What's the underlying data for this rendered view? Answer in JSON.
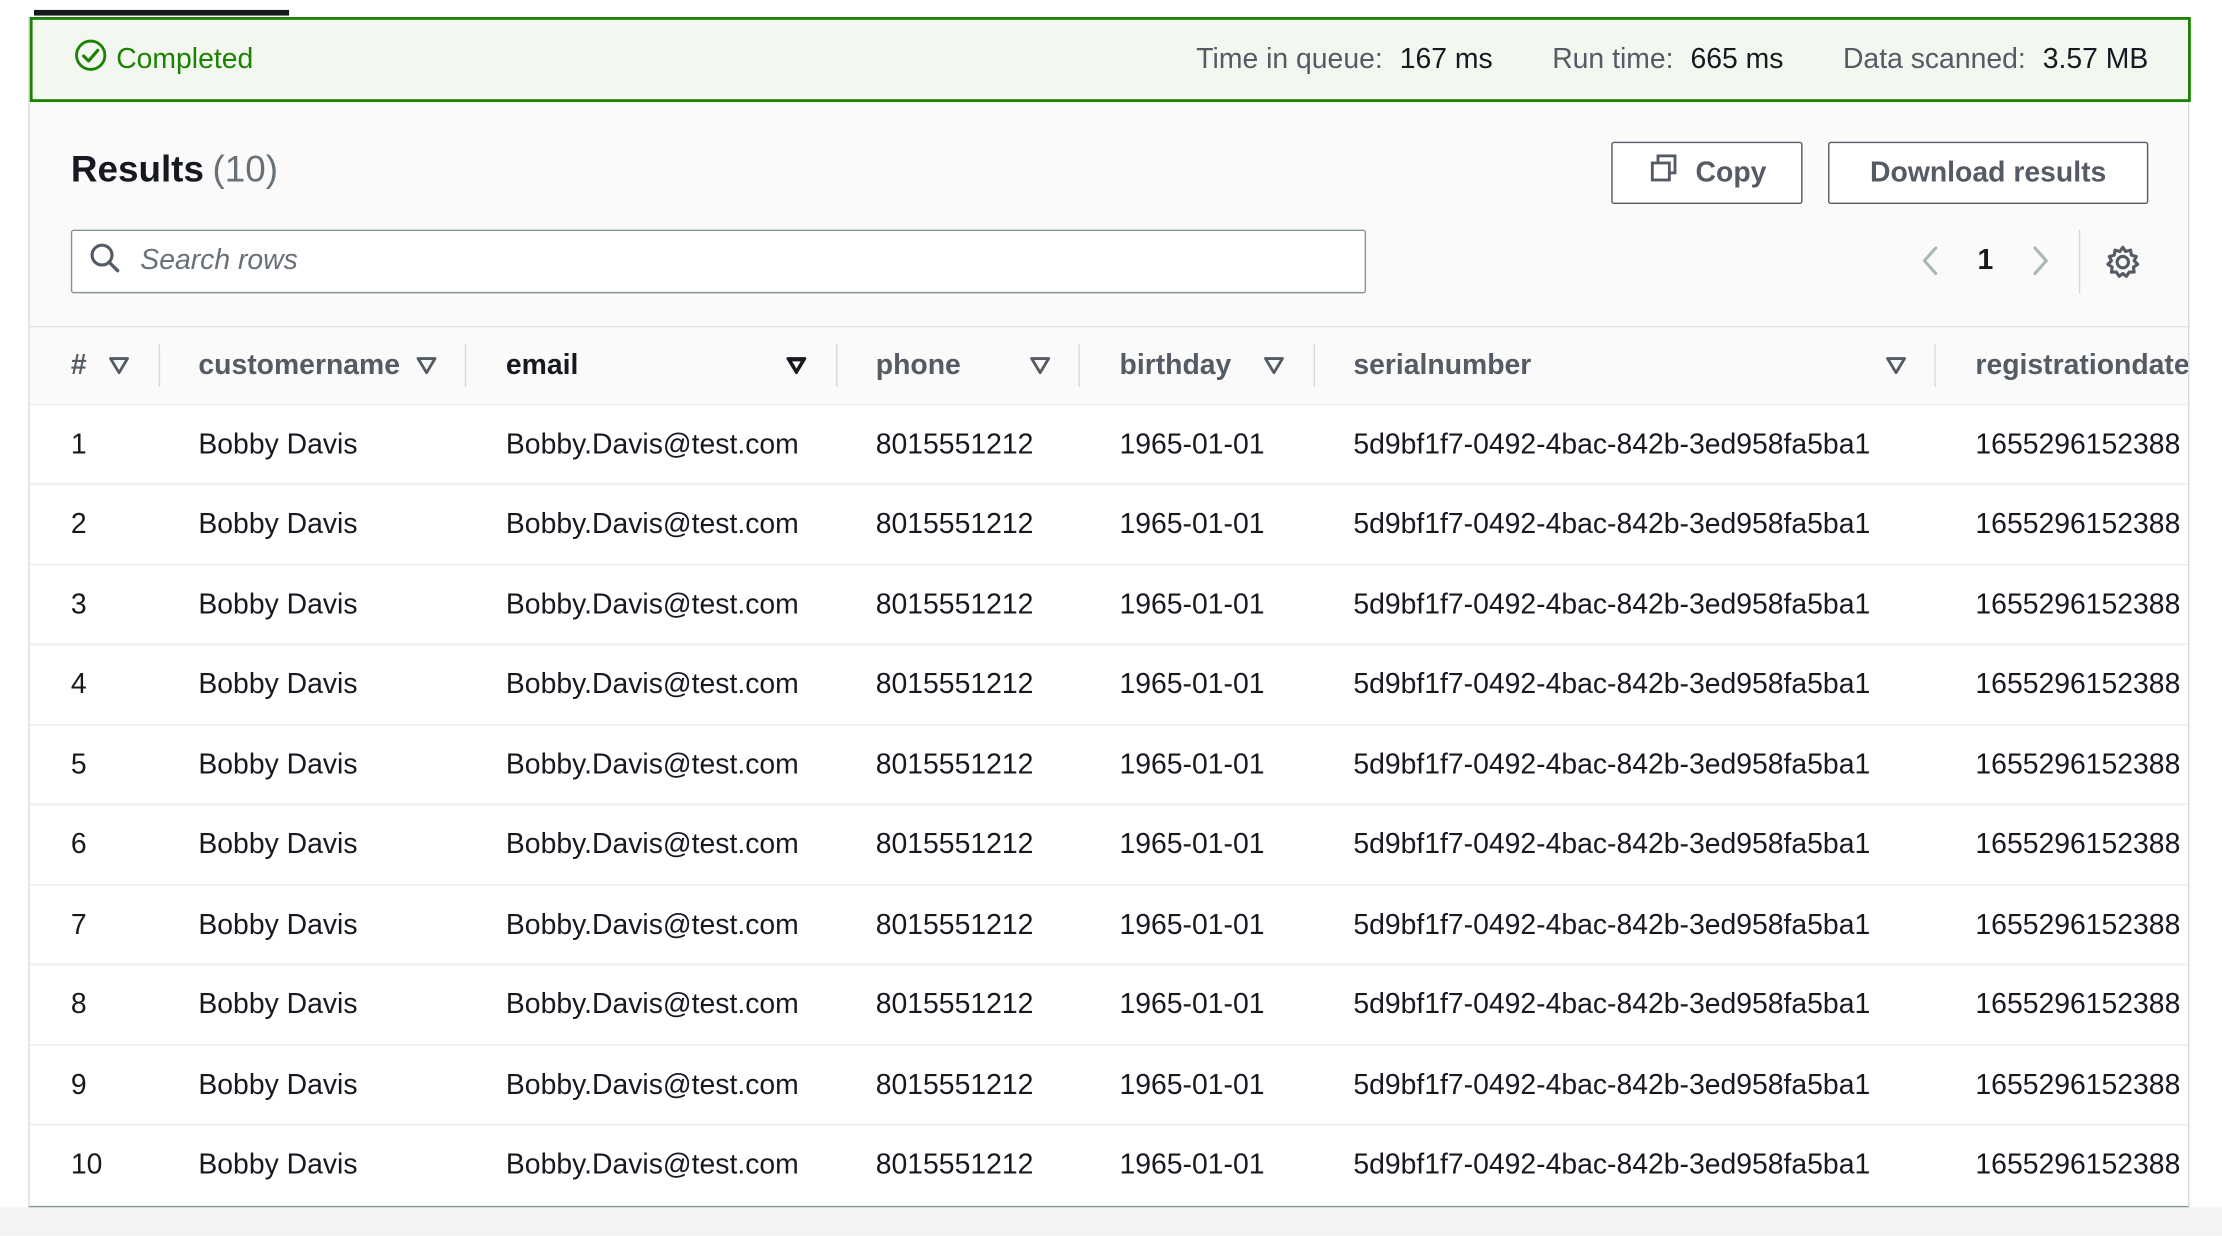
{
  "status": {
    "label": "Completed",
    "time_in_queue_label": "Time in queue:",
    "time_in_queue_value": "167 ms",
    "run_time_label": "Run time:",
    "run_time_value": "665 ms",
    "data_scanned_label": "Data scanned:",
    "data_scanned_value": "3.57 MB",
    "color": "#1d8102"
  },
  "results": {
    "title": "Results",
    "count": "(10)"
  },
  "toolbar": {
    "copy_label": "Copy",
    "download_label": "Download results"
  },
  "search": {
    "placeholder": "Search rows"
  },
  "pagination": {
    "current_page": "1"
  },
  "table": {
    "columns": [
      "#",
      "customername",
      "email",
      "phone",
      "birthday",
      "serialnumber",
      "registrationdate"
    ],
    "rows": [
      [
        "1",
        "Bobby Davis",
        "Bobby.Davis@test.com",
        "8015551212",
        "1965-01-01",
        "5d9bf1f7-0492-4bac-842b-3ed958fa5ba1",
        "1655296152388"
      ],
      [
        "2",
        "Bobby Davis",
        "Bobby.Davis@test.com",
        "8015551212",
        "1965-01-01",
        "5d9bf1f7-0492-4bac-842b-3ed958fa5ba1",
        "1655296152388"
      ],
      [
        "3",
        "Bobby Davis",
        "Bobby.Davis@test.com",
        "8015551212",
        "1965-01-01",
        "5d9bf1f7-0492-4bac-842b-3ed958fa5ba1",
        "1655296152388"
      ],
      [
        "4",
        "Bobby Davis",
        "Bobby.Davis@test.com",
        "8015551212",
        "1965-01-01",
        "5d9bf1f7-0492-4bac-842b-3ed958fa5ba1",
        "1655296152388"
      ],
      [
        "5",
        "Bobby Davis",
        "Bobby.Davis@test.com",
        "8015551212",
        "1965-01-01",
        "5d9bf1f7-0492-4bac-842b-3ed958fa5ba1",
        "1655296152388"
      ],
      [
        "6",
        "Bobby Davis",
        "Bobby.Davis@test.com",
        "8015551212",
        "1965-01-01",
        "5d9bf1f7-0492-4bac-842b-3ed958fa5ba1",
        "1655296152388"
      ],
      [
        "7",
        "Bobby Davis",
        "Bobby.Davis@test.com",
        "8015551212",
        "1965-01-01",
        "5d9bf1f7-0492-4bac-842b-3ed958fa5ba1",
        "1655296152388"
      ],
      [
        "8",
        "Bobby Davis",
        "Bobby.Davis@test.com",
        "8015551212",
        "1965-01-01",
        "5d9bf1f7-0492-4bac-842b-3ed958fa5ba1",
        "1655296152388"
      ],
      [
        "9",
        "Bobby Davis",
        "Bobby.Davis@test.com",
        "8015551212",
        "1965-01-01",
        "5d9bf1f7-0492-4bac-842b-3ed958fa5ba1",
        "1655296152388"
      ],
      [
        "10",
        "Bobby Davis",
        "Bobby.Davis@test.com",
        "8015551212",
        "1965-01-01",
        "5d9bf1f7-0492-4bac-842b-3ed958fa5ba1",
        "1655296152388"
      ]
    ]
  },
  "icons": {
    "status": "check-circle-icon",
    "copy": "copy-icon",
    "search": "search-icon",
    "prev": "chevron-left-icon",
    "next": "chevron-right-icon",
    "settings": "gear-icon",
    "sort": "caret-down-icon"
  }
}
